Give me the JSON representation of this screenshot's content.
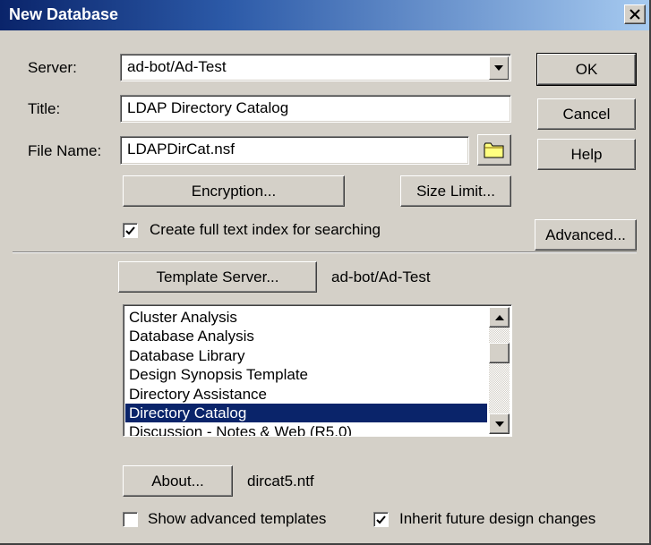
{
  "window": {
    "title": "New Database",
    "close_glyph": "✕"
  },
  "server": {
    "label": "Server:",
    "value": "ad-bot/Ad-Test"
  },
  "title_field": {
    "label": "Title:",
    "value": "LDAP Directory Catalog"
  },
  "file_name": {
    "label": "File Name:",
    "value": "LDAPDirCat.nsf"
  },
  "buttons": {
    "ok": "OK",
    "cancel": "Cancel",
    "help": "Help",
    "encryption": "Encryption...",
    "size_limit": "Size Limit...",
    "advanced": "Advanced...",
    "template_server": "Template Server...",
    "about": "About..."
  },
  "full_text_index": {
    "label": "Create full text index for searching",
    "checked": true
  },
  "template_server_value": "ad-bot/Ad-Test",
  "templates": {
    "items": [
      "Cluster Analysis",
      "Database Analysis",
      "Database Library",
      "Design Synopsis Template",
      "Directory Assistance",
      "Directory Catalog",
      "Discussion - Notes & Web (R5.0)"
    ],
    "selected": "Directory Catalog"
  },
  "template_file": "dircat5.ntf",
  "show_advanced_templates": {
    "label": "Show advanced templates",
    "checked": false
  },
  "inherit_design": {
    "label": "Inherit future design changes",
    "checked": true
  },
  "colors": {
    "face": "#d4d0c8",
    "selection": "#0a246a",
    "title_start": "#0a246a",
    "title_end": "#a6caf0"
  },
  "icons": {
    "folder": "folder-icon",
    "dropdown": "chevron-down-icon",
    "check": "check-icon"
  }
}
